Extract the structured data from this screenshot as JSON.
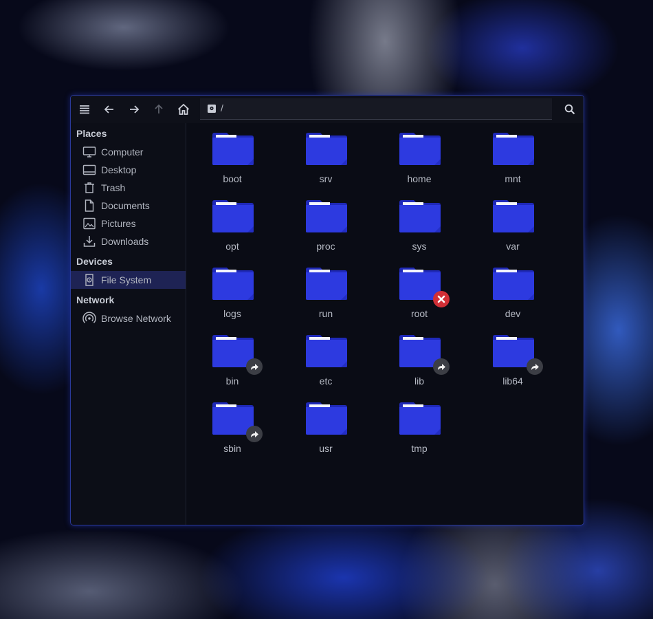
{
  "path": {
    "current": "/"
  },
  "sidebar": {
    "places_title": "Places",
    "places": [
      {
        "label": "Computer",
        "icon": "computer-icon"
      },
      {
        "label": "Desktop",
        "icon": "desktop-icon"
      },
      {
        "label": "Trash",
        "icon": "trash-icon"
      },
      {
        "label": "Documents",
        "icon": "documents-icon"
      },
      {
        "label": "Pictures",
        "icon": "pictures-icon"
      },
      {
        "label": "Downloads",
        "icon": "downloads-icon"
      }
    ],
    "devices_title": "Devices",
    "devices": [
      {
        "label": "File System",
        "icon": "drive-icon",
        "selected": true
      }
    ],
    "network_title": "Network",
    "network": [
      {
        "label": "Browse Network",
        "icon": "network-icon"
      }
    ]
  },
  "folders": [
    {
      "name": "boot",
      "emblem": ""
    },
    {
      "name": "srv",
      "emblem": ""
    },
    {
      "name": "home",
      "emblem": ""
    },
    {
      "name": "mnt",
      "emblem": ""
    },
    {
      "name": "opt",
      "emblem": ""
    },
    {
      "name": "proc",
      "emblem": ""
    },
    {
      "name": "sys",
      "emblem": ""
    },
    {
      "name": "var",
      "emblem": ""
    },
    {
      "name": "logs",
      "emblem": ""
    },
    {
      "name": "run",
      "emblem": ""
    },
    {
      "name": "root",
      "emblem": "unreadable"
    },
    {
      "name": "dev",
      "emblem": ""
    },
    {
      "name": "bin",
      "emblem": "symlink"
    },
    {
      "name": "etc",
      "emblem": ""
    },
    {
      "name": "lib",
      "emblem": "symlink"
    },
    {
      "name": "lib64",
      "emblem": "symlink"
    },
    {
      "name": "sbin",
      "emblem": "symlink"
    },
    {
      "name": "usr",
      "emblem": ""
    },
    {
      "name": "tmp",
      "emblem": ""
    }
  ],
  "colors": {
    "folder": "#2d3ae0",
    "folder_dark": "#1f29b8",
    "accent_border": "#2a3a9a",
    "selected_bg": "#1e2354"
  }
}
